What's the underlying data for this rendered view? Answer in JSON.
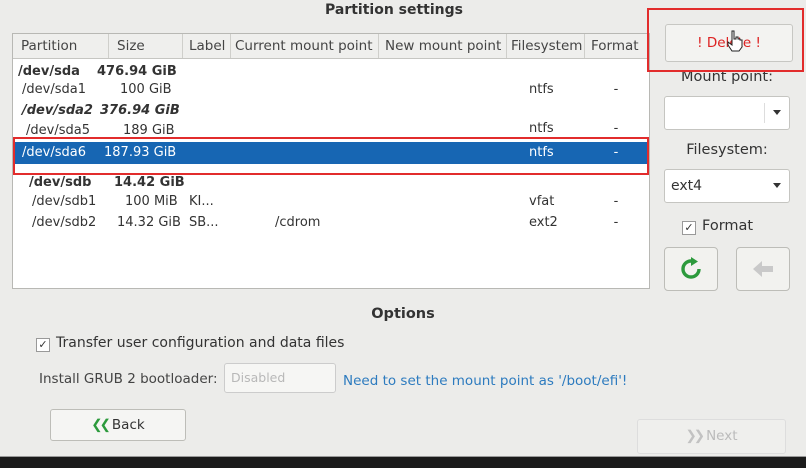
{
  "window": {
    "title": "Partition settings"
  },
  "table": {
    "columns": [
      "Partition",
      "Size",
      "Label",
      "Current mount point",
      "New mount point",
      "Filesystem",
      "Format"
    ],
    "rows": [
      {
        "partition": "/dev/sda",
        "size": "476.94 GiB",
        "label": "",
        "current_mount": "",
        "filesystem": "",
        "format": "",
        "style": "bold"
      },
      {
        "partition": "/dev/sda1",
        "size": "100 GiB",
        "label": "",
        "current_mount": "",
        "filesystem": "ntfs",
        "format": "-",
        "style": "normal"
      },
      {
        "partition": "/dev/sda2",
        "size": "376.94 GiB",
        "label": "",
        "current_mount": "",
        "filesystem": "",
        "format": "",
        "style": "italic"
      },
      {
        "partition": "/dev/sda5",
        "size": "189 GiB",
        "label": "",
        "current_mount": "",
        "filesystem": "ntfs",
        "format": "-",
        "style": "normal"
      },
      {
        "partition": "/dev/sda6",
        "size": "187.93 GiB",
        "label": "",
        "current_mount": "",
        "filesystem": "ntfs",
        "format": "-",
        "style": "selected"
      },
      {
        "partition": "/dev/sdb",
        "size": "14.42 GiB",
        "label": "",
        "current_mount": "",
        "filesystem": "",
        "format": "",
        "style": "bold"
      },
      {
        "partition": "/dev/sdb1",
        "size": "100 MiB",
        "label": "KI...",
        "current_mount": "",
        "filesystem": "vfat",
        "format": "-",
        "style": "normal"
      },
      {
        "partition": "/dev/sdb2",
        "size": "14.32 GiB",
        "label": "SB...",
        "current_mount": "/cdrom",
        "filesystem": "ext2",
        "format": "-",
        "style": "normal"
      }
    ]
  },
  "right_panel": {
    "delete_label": "! Delete !",
    "mount_point_label": "Mount point:",
    "mount_point_value": "",
    "filesystem_label": "Filesystem:",
    "filesystem_value": "ext4",
    "format_label": "Format",
    "format_checked": true,
    "refresh_icon": "refresh-icon",
    "back_arrow_icon": "left-arrow-icon"
  },
  "options": {
    "title": "Options",
    "transfer_label": "Transfer user configuration and data files",
    "transfer_checked": true,
    "grub_label": "Install GRUB 2 bootloader:",
    "grub_value": "Disabled",
    "grub_note": "Need to set the mount point as '/boot/efi'!"
  },
  "nav": {
    "back_label": "Back",
    "back_glyph": "❮❮",
    "next_label": "Next",
    "next_glyph": "❯❯"
  },
  "colors": {
    "selection": "#1766b3",
    "delete_text": "#dd2222",
    "highlight": "#e22c2c",
    "refresh_green": "#2c9a3c",
    "note_blue": "#2d7bbf"
  }
}
